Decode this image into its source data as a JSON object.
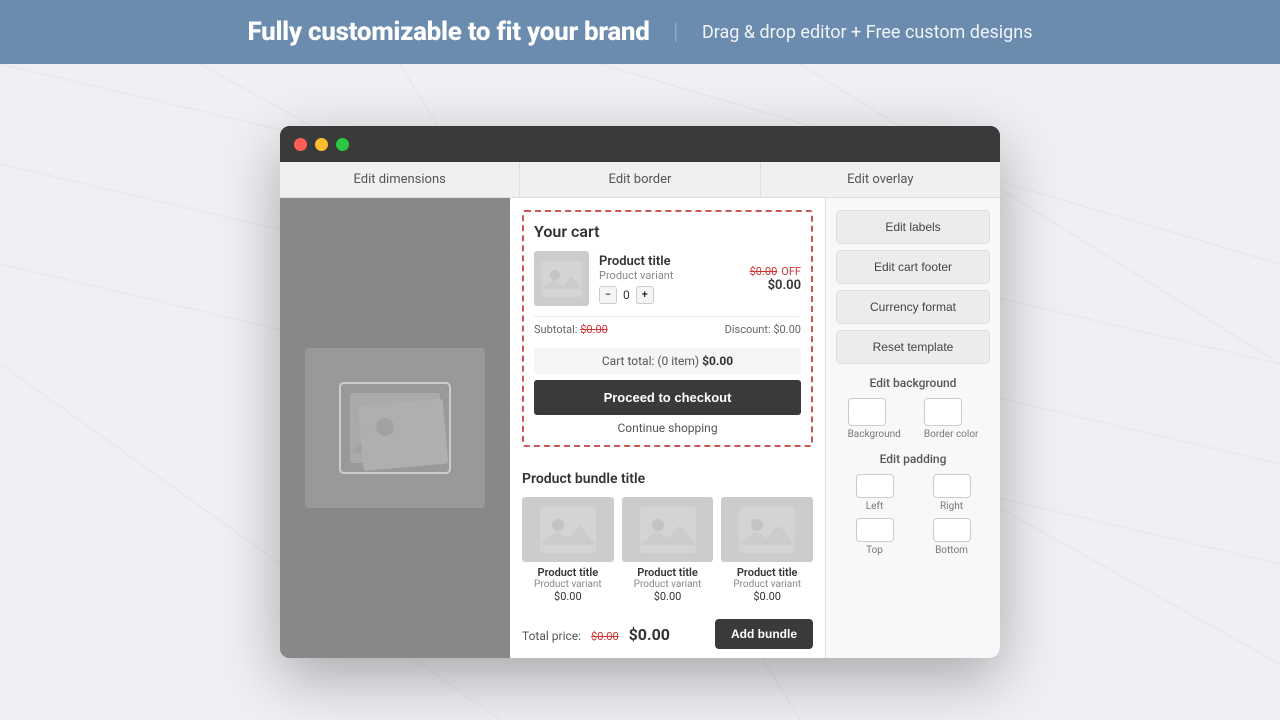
{
  "header": {
    "title": "Fully customizable to fit your brand",
    "divider": "|",
    "subtitle": "Drag & drop editor + Free custom designs"
  },
  "window": {
    "tabs": [
      {
        "label": "Edit dimensions"
      },
      {
        "label": "Edit border"
      },
      {
        "label": "Edit overlay"
      }
    ],
    "traffic_lights": {
      "red": "close",
      "yellow": "minimize",
      "green": "maximize"
    }
  },
  "cart": {
    "title": "Your cart",
    "item": {
      "title": "Product title",
      "variant": "Product variant",
      "qty": "0",
      "original_price": "$0.00",
      "off_label": "OFF",
      "price": "$0.00"
    },
    "subtotal_label": "Subtotal:",
    "subtotal_value": "$0.00",
    "discount_label": "Discount: $0.00",
    "cart_total": "Cart total: (0 item)",
    "cart_total_amount": "$0.00",
    "checkout_btn": "Proceed to checkout",
    "continue_link": "Continue shopping"
  },
  "bundle": {
    "title": "Product bundle title",
    "products": [
      {
        "title": "Product title",
        "variant": "Product variant",
        "price": "$0.00"
      },
      {
        "title": "Product title",
        "variant": "Product variant",
        "price": "$0.00"
      },
      {
        "title": "Product title",
        "variant": "Product variant",
        "price": "$0.00"
      }
    ],
    "total_label": "Total price:",
    "total_original": "$0.00",
    "total_price": "$0.00",
    "add_bundle_btn": "Add bundle"
  },
  "right_panel": {
    "edit_labels_btn": "Edit labels",
    "edit_cart_footer_btn": "Edit cart footer",
    "currency_format_btn": "Currency format",
    "reset_template_btn": "Reset template",
    "edit_background_label": "Edit background",
    "background_label": "Background",
    "border_color_label": "Border color",
    "edit_padding_label": "Edit padding",
    "left_label": "Left",
    "right_label": "Right",
    "top_label": "Top",
    "bottom_label": "Bottom"
  }
}
